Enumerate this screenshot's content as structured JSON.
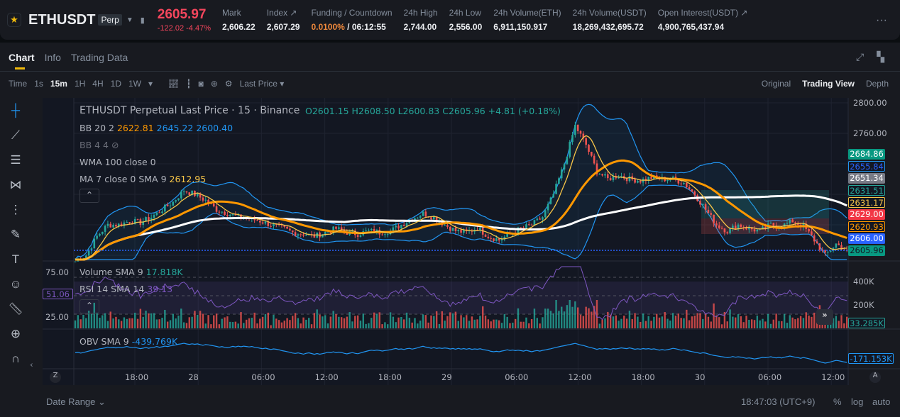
{
  "header": {
    "symbol": "ETHUSDT",
    "contract": "Perp",
    "last_price": "2605.97",
    "change": "-122.02 -4.47%",
    "stats": [
      {
        "label": "Mark",
        "value": "2,606.22"
      },
      {
        "label": "Index ↗",
        "value": "2,607.29"
      },
      {
        "label": "Funding / Countdown",
        "value_rate": "0.0100%",
        "value": "/ 06:12:55"
      },
      {
        "label": "24h High",
        "value": "2,744.00"
      },
      {
        "label": "24h Low",
        "value": "2,556.00"
      },
      {
        "label": "24h Volume(ETH)",
        "value": "6,911,150.917"
      },
      {
        "label": "24h Volume(USDT)",
        "value": "18,269,432,695.72"
      },
      {
        "label": "Open Interest(USDT) ↗",
        "value": "4,900,765,437.94"
      }
    ],
    "more": "···"
  },
  "tabs": [
    "Chart",
    "Info",
    "Trading Data"
  ],
  "toolbar": {
    "time": "Time",
    "intervals": [
      "1s",
      "15m",
      "1H",
      "4H",
      "1D",
      "1W"
    ],
    "price_type": "Last Price ▾",
    "views": [
      "Original",
      "Trading View",
      "Depth"
    ]
  },
  "legend": {
    "title": "ETHUSDT Perpetual Last Price · 15 · Binance",
    "o": "O2601.15",
    "h": "H2608.50",
    "l": "L2600.83",
    "c": "C2605.96",
    "chg": "+4.81 (+0.18%)",
    "bb": "BB 20 2",
    "bb_mid": "2622.81",
    "bb_up": "2645.22",
    "bb_lo": "2600.40",
    "bb44": "BB 4 4",
    "wma": "WMA 100 close 0",
    "ma": "MA 7 close 0 SMA 9",
    "ma_val": "2612.95",
    "vol": "Volume SMA 9",
    "vol_val": "17.818K",
    "rsi": "RSI 14 SMA 14",
    "rsi_val": "39.13",
    "obv": "OBV SMA 9",
    "obv_val": "-439.769K"
  },
  "price_axis": [
    "2800.00",
    "2760.00"
  ],
  "badges": [
    {
      "v": "2684.86",
      "bg": "#089981",
      "fg": "#fff"
    },
    {
      "v": "2655.84",
      "bg": "#131722",
      "fg": "#2962ff",
      "bd": "#2196f3"
    },
    {
      "v": "2651.34",
      "bg": "#787b86",
      "fg": "#fff"
    },
    {
      "v": "2631.51",
      "bg": "#131722",
      "fg": "#26a69a",
      "bd": "#26a69a"
    },
    {
      "v": "2631.17",
      "bg": "#131722",
      "fg": "#f7c548",
      "bd": "#f7c548"
    },
    {
      "v": "2629.00",
      "bg": "#f23645",
      "fg": "#fff"
    },
    {
      "v": "2620.93",
      "bg": "#131722",
      "fg": "#ff9800",
      "bd": "#ff9800"
    },
    {
      "v": "2606.00",
      "bg": "#2962ff",
      "fg": "#fff"
    },
    {
      "v": "2605.96",
      "bg": "#089981",
      "fg": "#131722"
    }
  ],
  "vol_axis": [
    "400K",
    "200K"
  ],
  "vol_badge": "33.285K",
  "rsi_axis": [
    "75.00",
    "25.00"
  ],
  "rsi_badge": "51.06",
  "obv_badge": "-171.153K",
  "time_axis": [
    "18:00",
    "28",
    "06:00",
    "12:00",
    "18:00",
    "29",
    "06:00",
    "12:00",
    "18:00",
    "30",
    "06:00",
    "12:00"
  ],
  "footer": {
    "date_range": "Date Range ⌄",
    "clock": "18:47:03 (UTC+9)",
    "pct": "%",
    "log": "log",
    "auto": "auto",
    "z": "Z",
    "a": "A"
  },
  "chart_data": {
    "type": "candlestick",
    "interval": "15m",
    "note": "hourly closes approximated",
    "ylim": [
      2592,
      2808
    ],
    "closes": [
      2592,
      2600,
      2625,
      2640,
      2640,
      2645,
      2643,
      2650,
      2660,
      2670,
      2685,
      2680,
      2672,
      2660,
      2655,
      2650,
      2648,
      2645,
      2640,
      2636,
      2630,
      2628,
      2625,
      2630,
      2635,
      2630,
      2628,
      2632,
      2630,
      2632,
      2640,
      2648,
      2655,
      2650,
      2640,
      2632,
      2630,
      2636,
      2625,
      2620,
      2628,
      2635,
      2640,
      2650,
      2680,
      2720,
      2770,
      2745,
      2710,
      2700,
      2705,
      2700,
      2698,
      2702,
      2700,
      2700,
      2695,
      2680,
      2660,
      2640,
      2632,
      2640,
      2635,
      2632,
      2640,
      2638,
      2645,
      2638,
      2620,
      2600,
      2615,
      2606
    ]
  },
  "colors": {
    "up": "#26a69a",
    "down": "#ef5350",
    "bb": "#2196f3",
    "ma": "#ff9800",
    "wma": "#ffffff",
    "sma": "#f7c548",
    "rsi": "#7e57c2",
    "obv": "#2196f3"
  }
}
